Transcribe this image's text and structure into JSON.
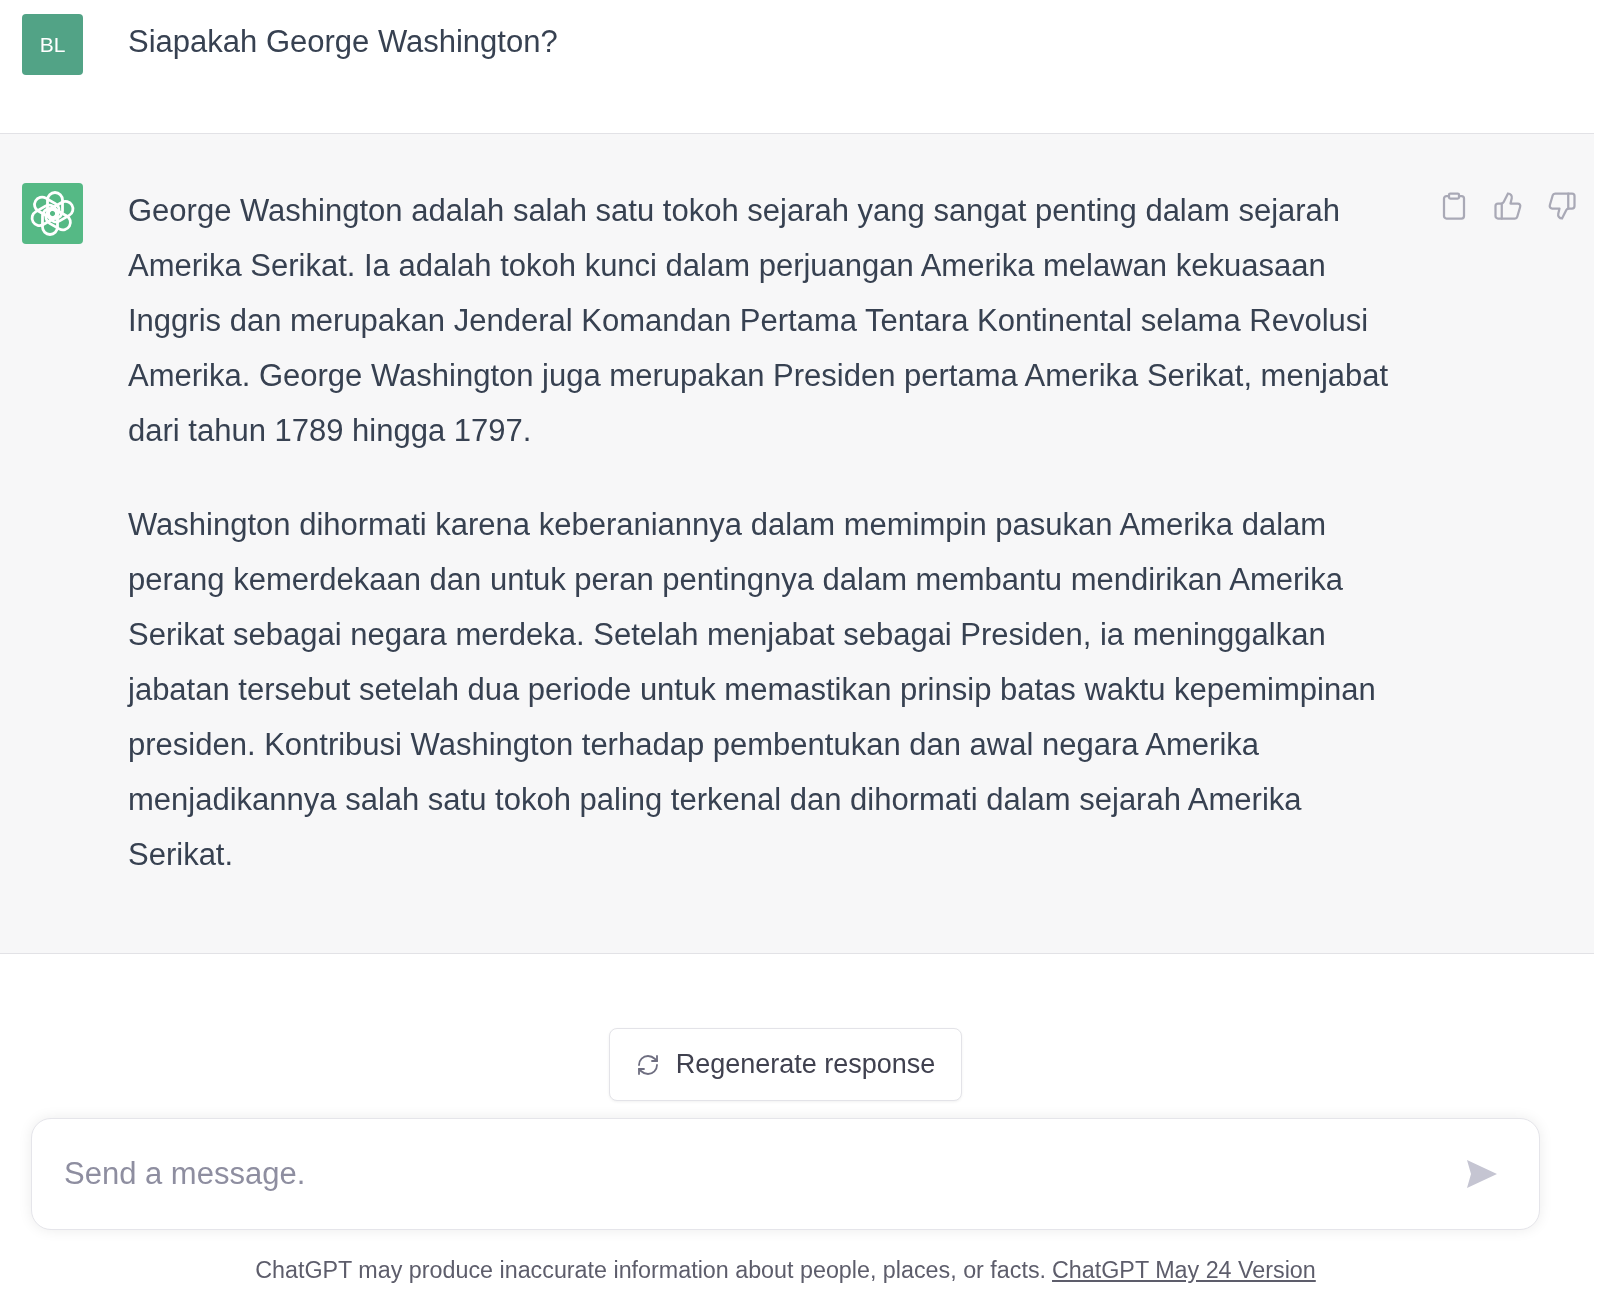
{
  "conversation": [
    {
      "kind": "user",
      "avatar_initials": "BL",
      "paragraphs": [
        "Siapakah George Washington?"
      ]
    },
    {
      "kind": "assistant",
      "paragraphs": [
        "George Washington adalah salah satu tokoh sejarah yang sangat penting dalam sejarah Amerika Serikat. Ia adalah tokoh kunci dalam perjuangan Amerika melawan kekuasaan Inggris dan merupakan Jenderal Komandan Pertama Tentara Kontinental selama Revolusi Amerika. George Washington juga merupakan Presiden pertama Amerika Serikat, menjabat dari tahun 1789 hingga 1797.",
        "Washington dihormati karena keberaniannya dalam memimpin pasukan Amerika dalam perang kemerdekaan dan untuk peran pentingnya dalam membantu mendirikan Amerika Serikat sebagai negara merdeka. Setelah menjabat sebagai Presiden, ia meninggalkan jabatan tersebut setelah dua periode untuk memastikan prinsip batas waktu kepemimpinan presiden. Kontribusi Washington terhadap pembentukan dan awal negara Amerika menjadikannya salah satu tokoh paling terkenal dan dihormati dalam sejarah Amerika Serikat."
      ]
    }
  ],
  "regenerate_button": {
    "label": "Regenerate response"
  },
  "composer": {
    "placeholder": "Send a message.",
    "send_button": {
      "disabled": true
    }
  },
  "footer": {
    "text": "ChatGPT may produce inaccurate information about people, places, or facts.",
    "link": "ChatGPT May 24 Version"
  }
}
